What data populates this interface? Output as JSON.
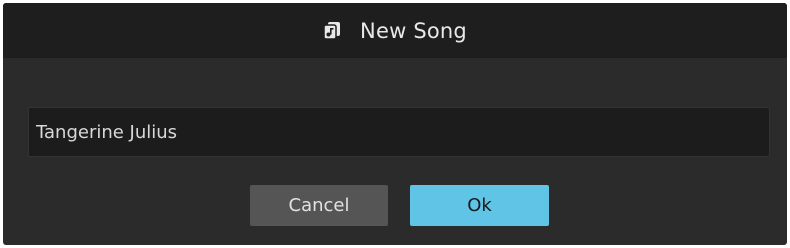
{
  "dialog": {
    "title": "New Song",
    "title_icon": "song-document-icon",
    "name_field": {
      "value": "Tangerine Julius",
      "placeholder": ""
    },
    "buttons": {
      "cancel_label": "Cancel",
      "ok_label": "Ok"
    }
  },
  "colors": {
    "dialog_background": "#2b2b2b",
    "titlebar_background": "#1e1e1e",
    "input_background": "#1c1c1c",
    "cancel_button": "#555555",
    "ok_button_accent": "#5fc4e6"
  }
}
